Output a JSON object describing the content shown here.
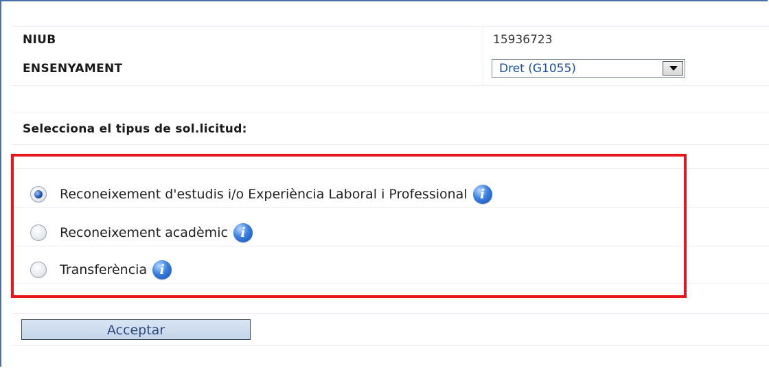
{
  "fields": {
    "niub_label": "NIUB",
    "niub_value": "15936723",
    "ensenyament_label": "ENSENYAMENT",
    "ensenyament_selected": "Dret (G1055)"
  },
  "section": {
    "title": "Selecciona el tipus de sol.licitud:"
  },
  "options": [
    {
      "label": "Reconeixement d'estudis i/o Experiència Laboral i Professional",
      "checked": true
    },
    {
      "label": "Reconeixement acadèmic",
      "checked": false
    },
    {
      "label": "Transferència",
      "checked": false
    }
  ],
  "info_icon_glyph": "i",
  "actions": {
    "accept_label": "Acceptar"
  },
  "colors": {
    "highlight_border": "#e8161b",
    "accent_blue": "#1a4fa0"
  }
}
